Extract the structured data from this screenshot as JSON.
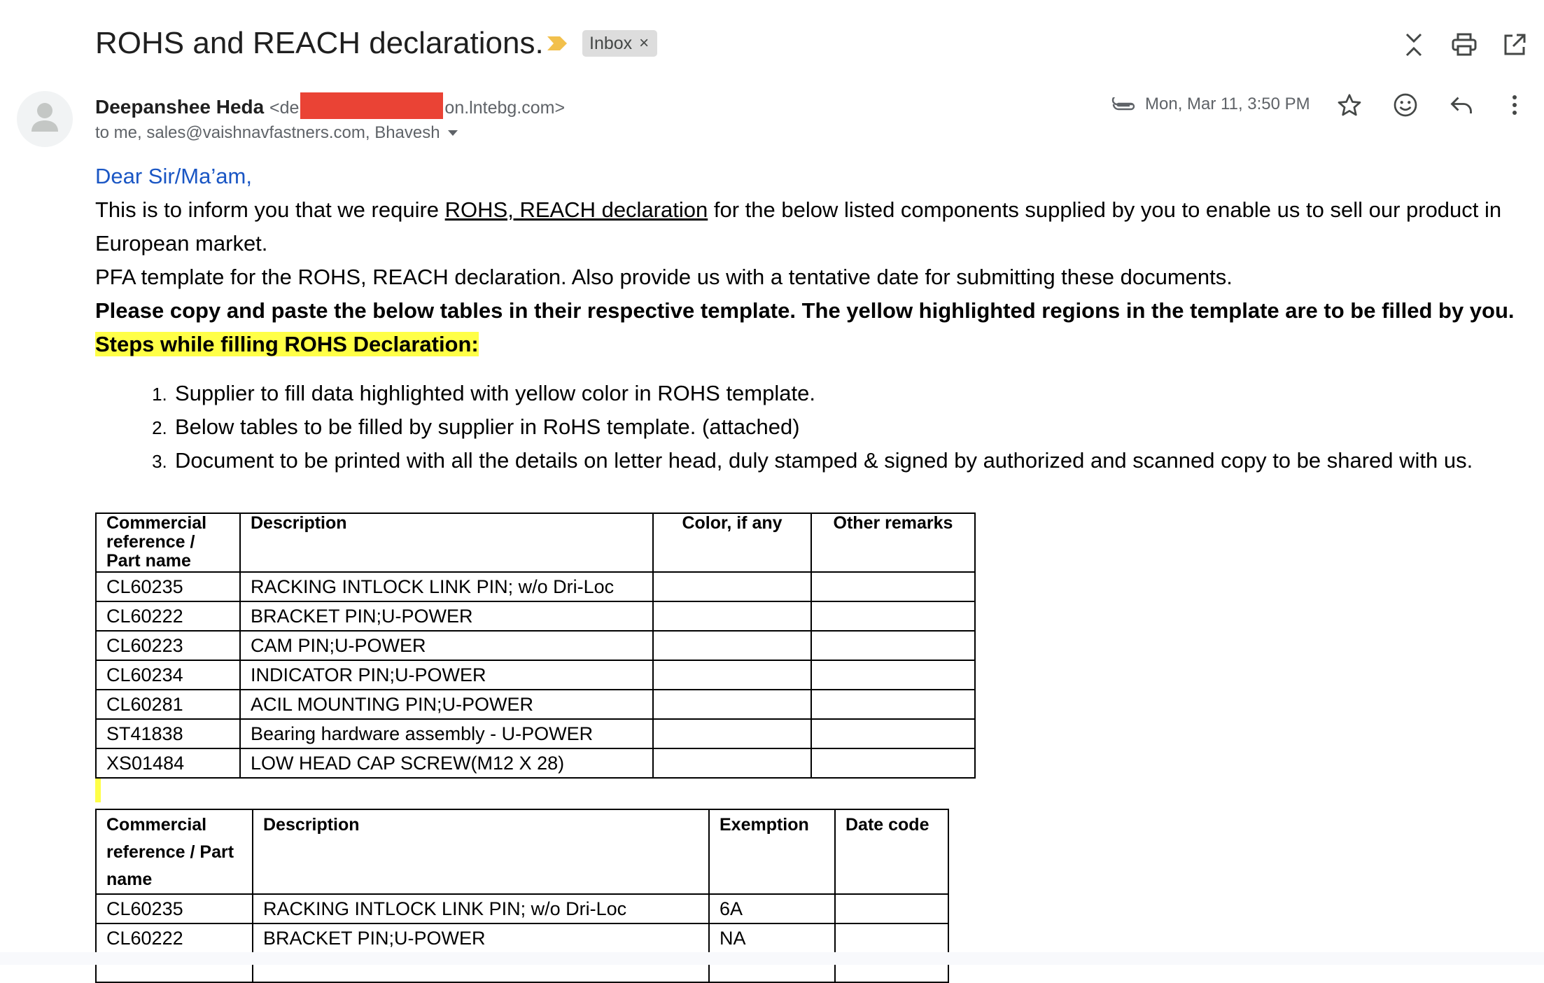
{
  "email": {
    "subject": "ROHS and REACH declarations.",
    "label_chip": "Inbox",
    "label_chip_close": "×",
    "sender_name": "Deepanshee Heda",
    "sender_email_prefix": "<de",
    "sender_email_suffix": "on.lntebg.com>",
    "recipients": "to me, sales@vaishnavfastners.com, Bhavesh",
    "date": "Mon, Mar 11, 3:50 PM"
  },
  "icons": {
    "importance": "importance-marker-icon",
    "collapse": "collapse-all-icon",
    "print": "print-icon",
    "open_new_window": "open-in-new-window-icon",
    "attachment": "attachment-icon",
    "star": "star-icon",
    "emoji": "emoji-react-icon",
    "reply": "reply-icon",
    "more": "more-vert-icon",
    "avatar": "person-avatar-icon",
    "dropdown": "caret-down-icon"
  },
  "colors": {
    "greeting": "#1a56c4",
    "highlight": "#ffff47",
    "redaction": "#ea4335",
    "importance": "#f2c04c"
  },
  "body": {
    "greeting": "Dear Sir/Ma’am,",
    "para1_pre": "This is to inform you that we require ",
    "para1_link": "ROHS, REACH declaration",
    "para1_post": " for the below listed components supplied by you to enable us to sell our product in European market.",
    "para2": "PFA template for the ROHS, REACH declaration. Also provide us with a tentative date for submitting these documents.",
    "para3": "Please copy and paste the below tables in their respective template. The yellow highlighted regions in the template are to be filled by you.",
    "steps_heading": "Steps while filling ROHS Declaration:",
    "steps": [
      "Supplier to fill data highlighted with yellow color in ROHS template.",
      "Below tables to be filled by supplier in RoHS template. (attached)",
      "Document to be printed with all the details on letter head, duly stamped & signed by authorized and scanned copy to be shared with us."
    ]
  },
  "table1": {
    "headers": [
      "Commercial reference / Part name",
      "Description",
      "Color, if any",
      "Other remarks"
    ],
    "rows": [
      [
        "CL60235",
        "RACKING INTLOCK LINK PIN;  w/o Dri-Loc",
        "",
        ""
      ],
      [
        "CL60222",
        "BRACKET PIN;U-POWER",
        "",
        ""
      ],
      [
        "CL60223",
        "CAM PIN;U-POWER",
        "",
        ""
      ],
      [
        "CL60234",
        "INDICATOR PIN;U-POWER",
        "",
        ""
      ],
      [
        "CL60281",
        "ACIL MOUNTING PIN;U-POWER",
        "",
        ""
      ],
      [
        "ST41838",
        "Bearing hardware assembly - U-POWER",
        "",
        ""
      ],
      [
        "XS01484",
        "LOW HEAD CAP SCREW(M12 X 28)",
        "",
        ""
      ]
    ]
  },
  "table2": {
    "headers": [
      "Commercial reference / Part name",
      "Description",
      "Exemption",
      "Date code"
    ],
    "rows": [
      [
        "CL60235",
        "RACKING INTLOCK LINK PIN;  w/o Dri-Loc",
        "6A",
        ""
      ],
      [
        "CL60222",
        "BRACKET PIN;U-POWER",
        "NA",
        ""
      ]
    ]
  }
}
